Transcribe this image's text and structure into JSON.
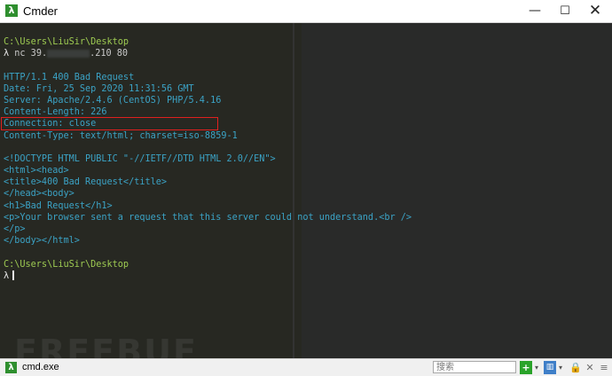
{
  "window": {
    "title": "Cmder",
    "minimize": "—",
    "maximize": "☐",
    "close": "✕"
  },
  "terminal": {
    "prompt_path": "C:\\Users\\LiuSir\\Desktop",
    "prompt_symbol": "λ",
    "command_prefix": "nc 39.",
    "command_suffix": ".210 80",
    "response": [
      "HTTP/1.1 400 Bad Request",
      "Date: Fri, 25 Sep 2020 11:31:56 GMT",
      "Server: Apache/2.4.6 (CentOS) PHP/5.4.16",
      "Content-Length: 226",
      "Connection: close",
      "Content-Type: text/html; charset=iso-8859-1"
    ],
    "html_body": [
      "<!DOCTYPE HTML PUBLIC \"-//IETF//DTD HTML 2.0//EN\">",
      "<html><head>",
      "<title>400 Bad Request</title>",
      "</head><body>",
      "<h1>Bad Request</h1>",
      "<p>Your browser sent a request that this server could not understand.<br />",
      "</p>",
      "</body></html>"
    ]
  },
  "watermark": "FREEBUF",
  "taskbar": {
    "tab_icon": "λ",
    "tab_label": "cmd.exe",
    "search_placeholder": "搜索",
    "icons": {
      "add": "+",
      "dropdown": "▾",
      "split": "▥",
      "lock": "🔒",
      "close": "✕",
      "menu": "≡"
    }
  }
}
